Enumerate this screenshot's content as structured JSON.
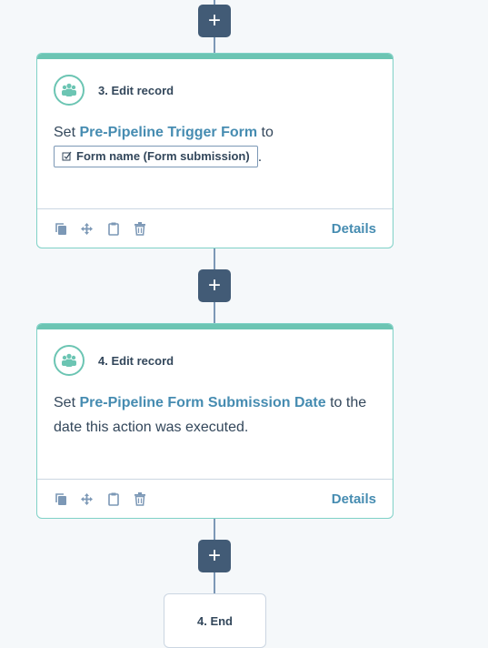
{
  "add_action_label": "+",
  "cards": [
    {
      "title": "3. Edit record",
      "text_before": "Set",
      "property": "Pre-Pipeline Trigger Form",
      "text_mid": "to",
      "token_label": "Form name (Form submission)",
      "text_after": ".",
      "details_label": "Details",
      "toolbar_icons": [
        "clone-icon",
        "move-icon",
        "clipboard-icon",
        "trash-icon"
      ]
    },
    {
      "title": "4. Edit record",
      "text_before": "Set",
      "property": "Pre-Pipeline Form Submission Date",
      "text_after": "to the date this action was executed.",
      "details_label": "Details",
      "toolbar_icons": [
        "clone-icon",
        "move-icon",
        "clipboard-icon",
        "trash-icon"
      ]
    }
  ],
  "end": {
    "label": "4. End"
  },
  "colors": {
    "accent": "#6cc5b3",
    "link": "#468cb1",
    "button": "#425b76",
    "connector": "#7c98b6"
  }
}
